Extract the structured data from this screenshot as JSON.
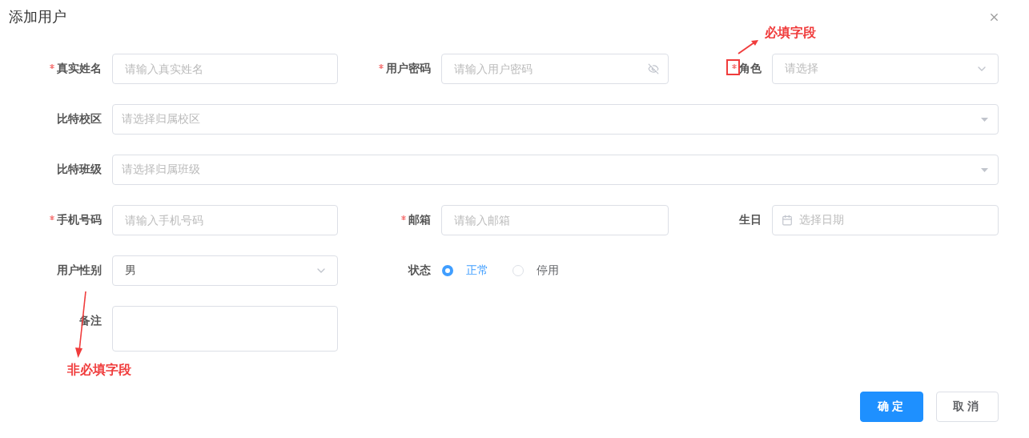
{
  "dialog": {
    "title": "添加用户"
  },
  "fields": [
    {
      "kind": "input",
      "label": "真实姓名",
      "required": true,
      "placeholder": "请输入真实姓名"
    },
    {
      "kind": "password",
      "label": "用户密码",
      "required": true,
      "placeholder": "请输入用户密码"
    },
    {
      "kind": "select",
      "label": "角色",
      "required": true,
      "highlighted": true,
      "placeholder": "请选择"
    },
    {
      "kind": "wide-select",
      "label": "比特校区",
      "required": false,
      "placeholder": "请选择归属校区"
    },
    {
      "kind": "wide-select",
      "label": "比特班级",
      "required": false,
      "placeholder": "请选择归属班级"
    },
    {
      "kind": "input",
      "label": "手机号码",
      "required": true,
      "placeholder": "请输入手机号码"
    },
    {
      "kind": "input",
      "label": "邮箱",
      "required": true,
      "placeholder": "请输入邮箱"
    },
    {
      "kind": "date",
      "label": "生日",
      "required": false,
      "placeholder": "选择日期"
    },
    {
      "kind": "select",
      "label": "用户性别",
      "required": false,
      "value": "男"
    },
    {
      "kind": "radio",
      "label": "状态",
      "required": false,
      "options": [
        {
          "label": "正常",
          "selected": true
        },
        {
          "label": "停用",
          "selected": false
        }
      ]
    },
    {
      "kind": "textarea",
      "label": "备注",
      "required": false
    }
  ],
  "annotations": [
    {
      "kind": "required-note",
      "text": "必填字段"
    },
    {
      "kind": "optional-note",
      "text": "非必填字段"
    }
  ],
  "buttons": [
    {
      "label": "确定",
      "kind": "primary"
    },
    {
      "label": "取消",
      "kind": "default"
    }
  ]
}
